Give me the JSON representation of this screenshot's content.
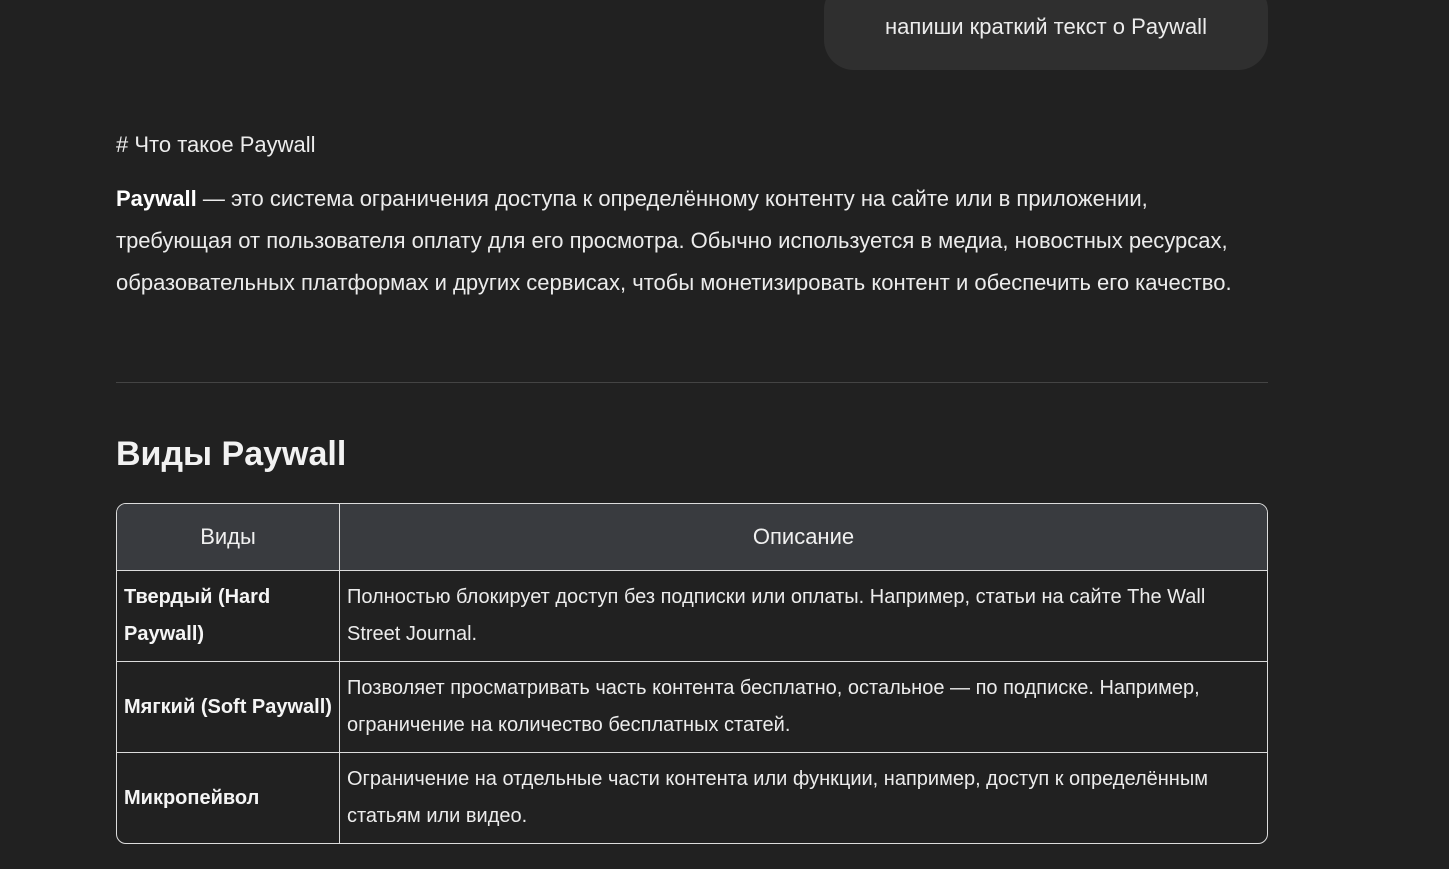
{
  "user_message": "напиши краткий текст о Paywall",
  "response": {
    "raw_heading": "# Что такое Paywall",
    "intro_bold": "Paywall",
    "intro_text": " — это система ограничения доступа к определённому контенту на сайте или в приложении, требующая от пользователя оплату для его просмотра. Обычно используется в медиа, новостных ресурсах, образовательных платформах и других сервисах, чтобы монетизировать контент и обеспечить его качество.",
    "section_title": "Виды Paywall",
    "table": {
      "headers": [
        "Виды",
        "Описание"
      ],
      "rows": [
        {
          "type": "Твердый (Hard Paywall)",
          "description": "Полностью блокирует доступ без подписки или оплаты. Например, статьи на сайте The Wall Street Journal."
        },
        {
          "type": "Мягкий (Soft Paywall)",
          "description": "Позволяет просматривать часть контента бесплатно, остальное — по подписке. Например, ограничение на количество бесплатных статей."
        },
        {
          "type": "Микропейвол",
          "description": "Ограничение на отдельные части контента или функции, например, доступ к определённым статьям или видео."
        }
      ]
    }
  }
}
